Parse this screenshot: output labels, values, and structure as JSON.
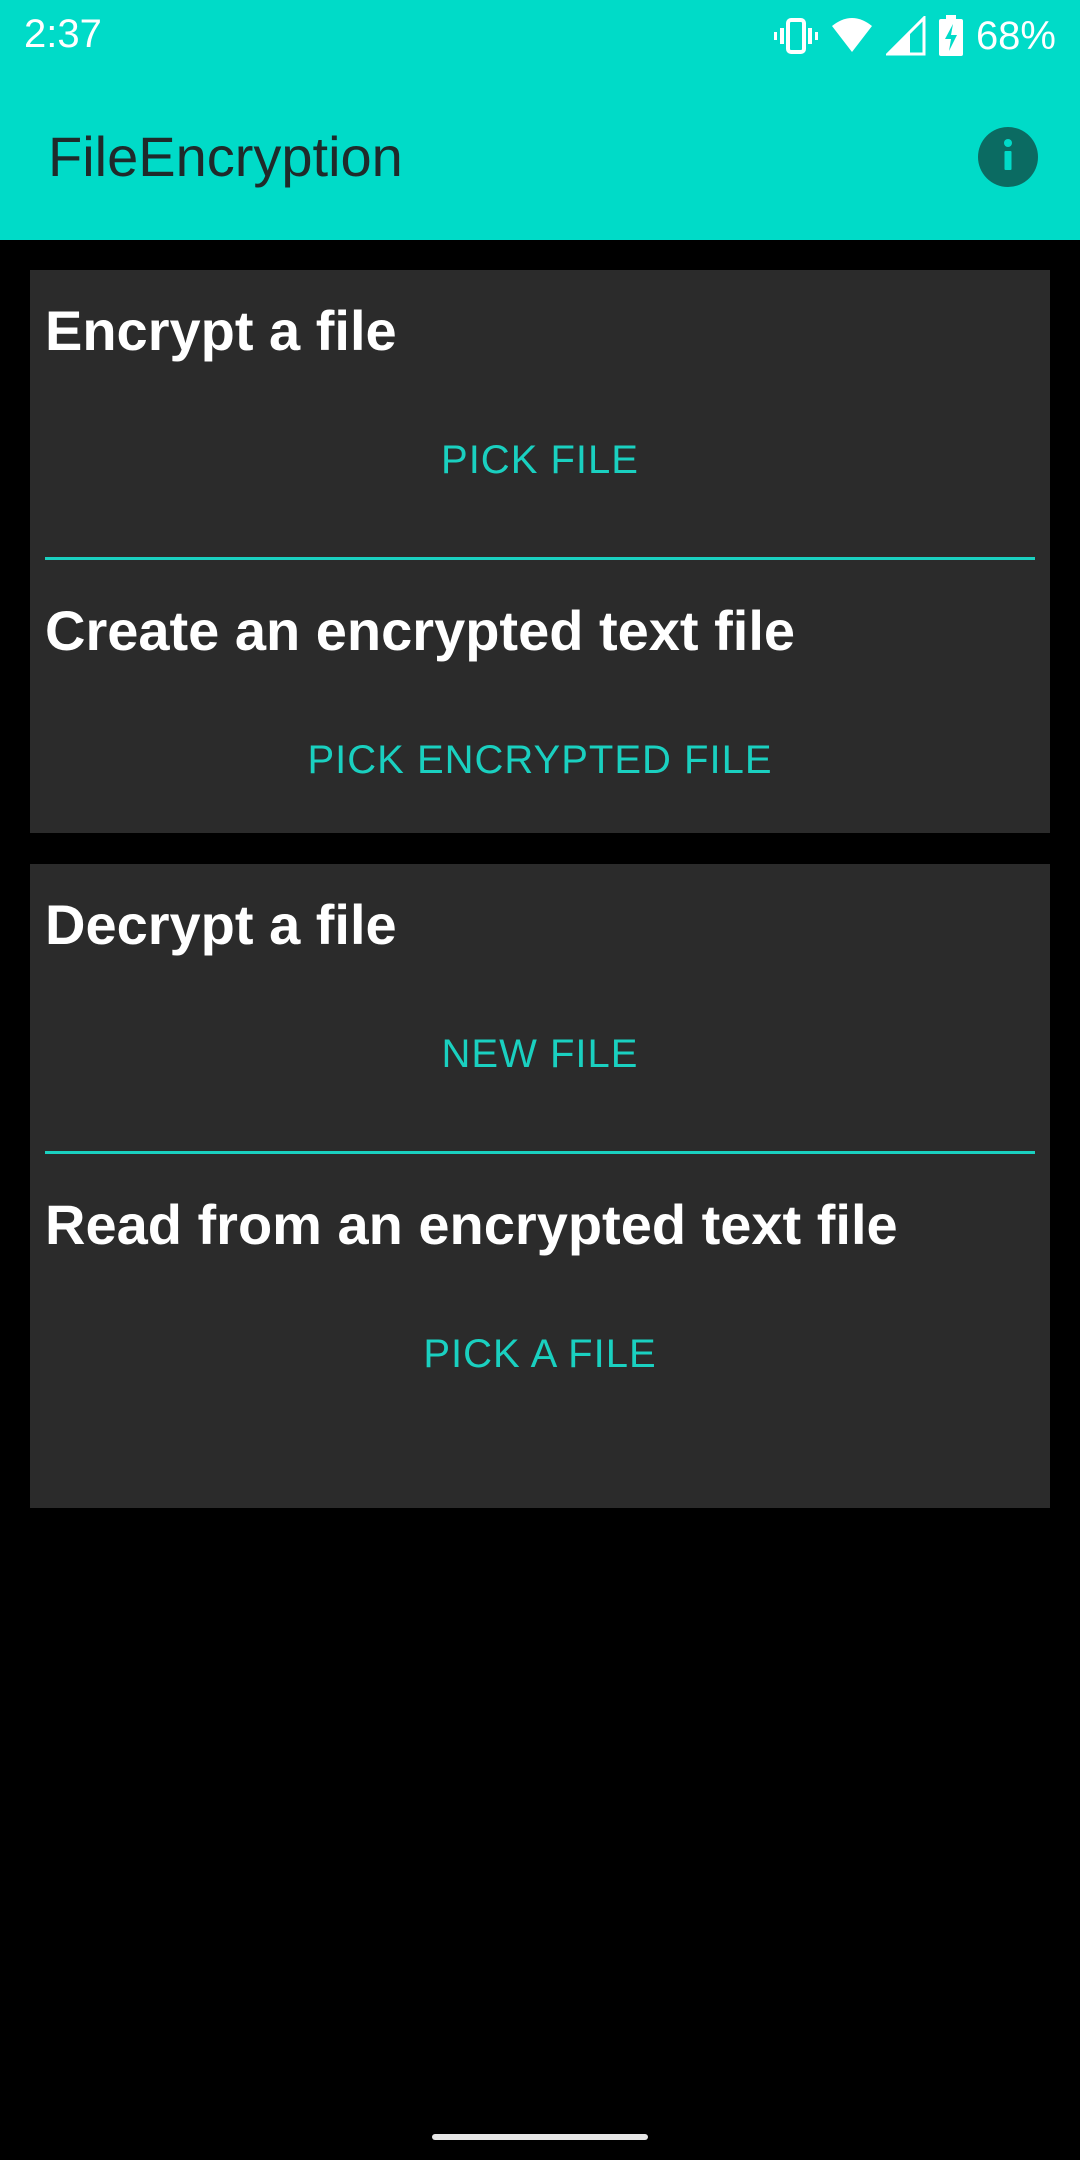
{
  "status_bar": {
    "time": "2:37",
    "battery_percent": "68%",
    "icons": [
      "vibrate-icon",
      "wifi-icon",
      "signal-icon",
      "battery-charging-icon"
    ]
  },
  "app_bar": {
    "title": "FileEncryption",
    "info_icon": "info-icon",
    "background_color": "#00dbc8"
  },
  "encrypt_card": {
    "encrypt_file": {
      "title": "Encrypt a file",
      "button": "PICK FILE"
    },
    "create_text_file": {
      "title": "Create an encrypted text file",
      "button": "PICK ENCRYPTED FILE"
    }
  },
  "decrypt_card": {
    "decrypt_file": {
      "title": "Decrypt a file",
      "button": "NEW FILE"
    },
    "read_text_file": {
      "title": "Read from an encrypted text file",
      "button": "PICK A FILE"
    }
  },
  "colors": {
    "accent": "#1ad0c0",
    "card_background": "#2b2b2b",
    "page_background": "#000000"
  }
}
